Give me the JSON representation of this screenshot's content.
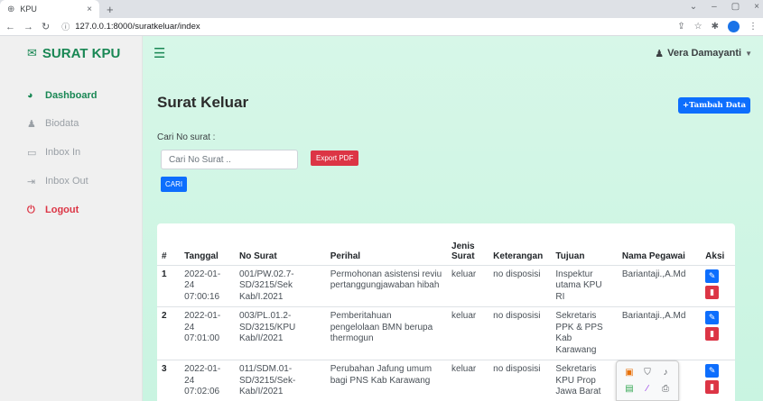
{
  "browser": {
    "tab_title": "KPU",
    "url": "127.0.0.1:8000/suratkeluar/index"
  },
  "sidebar": {
    "brand": "SURAT KPU",
    "items": [
      {
        "label": "Dashboard"
      },
      {
        "label": "Biodata"
      },
      {
        "label": "Inbox In"
      },
      {
        "label": "Inbox Out"
      },
      {
        "label": "Logout"
      }
    ]
  },
  "header": {
    "user": "Vera Damayanti"
  },
  "page": {
    "title": "Surat Keluar",
    "add_button": "+Tambah Data",
    "search_label": "Cari No surat :",
    "search_placeholder": "Cari No Surat ..",
    "export_button": "Export PDF",
    "search_button": "CARI"
  },
  "table": {
    "headers": [
      "#",
      "Tanggal",
      "No Surat",
      "Perihal",
      "Jenis Surat",
      "Keterangan",
      "Tujuan",
      "Nama Pegawai",
      "Aksi"
    ],
    "rows": [
      {
        "num": "1",
        "tanggal": "2022-01-24 07:00:16",
        "no_surat": "001/PW.02.7-SD/3215/Sek Kab/I.2021",
        "perihal": "Permohonan asistensi reviu pertanggungjawaban hibah",
        "jenis": "keluar",
        "keterangan": "no disposisi",
        "tujuan": "Inspektur utama KPU RI",
        "pegawai": "Bariantaji.,A.Md"
      },
      {
        "num": "2",
        "tanggal": "2022-01-24 07:01:00",
        "no_surat": "003/PL.01.2-SD/3215/KPU Kab/I/2021",
        "perihal": "Pemberitahuan pengelolaan BMN berupa thermogun",
        "jenis": "keluar",
        "keterangan": "no disposisi",
        "tujuan": "Sekretaris PPK & PPS Kab Karawang",
        "pegawai": "Bariantaji.,A.Md"
      },
      {
        "num": "3",
        "tanggal": "2022-01-24 07:02:06",
        "no_surat": "011/SDM.01-SD/3215/Sek-Kab/I/2021",
        "perihal": "Perubahan Jafung umum bagi PNS Kab Karawang",
        "jenis": "keluar",
        "keterangan": "no disposisi",
        "tujuan": "Sekretaris KPU Prop Jawa Barat",
        "pegawai": ""
      }
    ]
  }
}
